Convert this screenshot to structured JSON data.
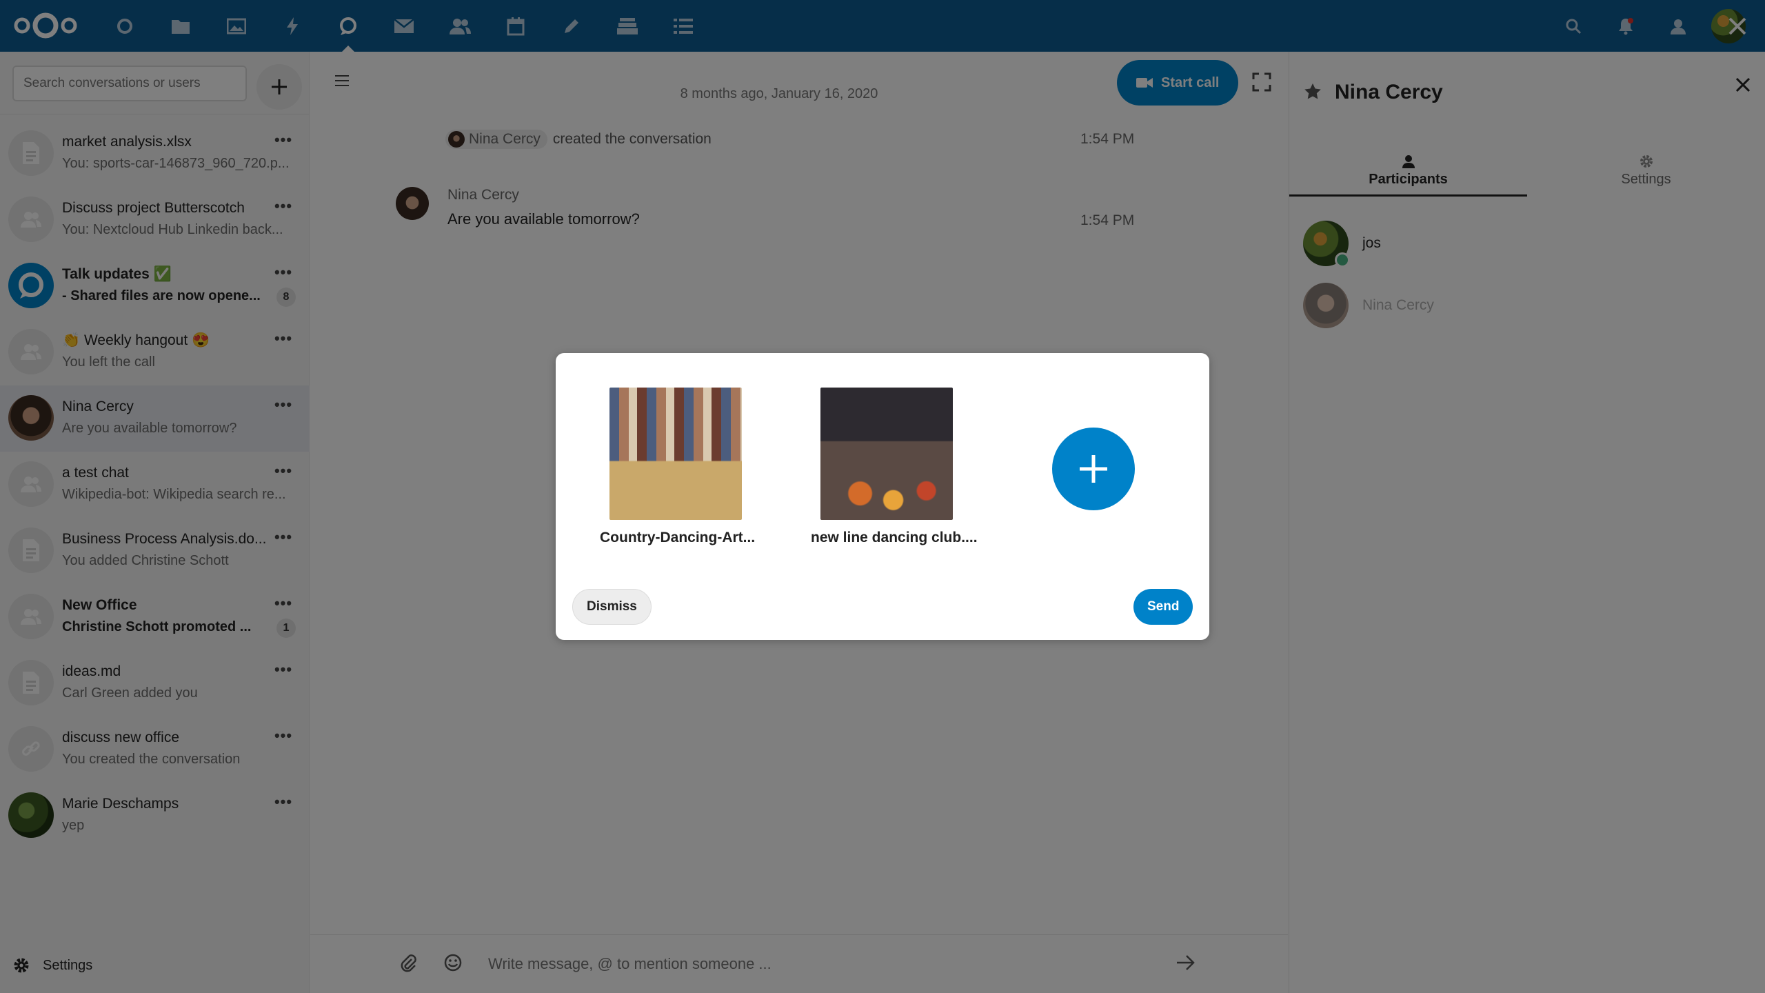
{
  "header": {
    "apps": [
      "dashboard",
      "files",
      "photos",
      "activity",
      "talk",
      "mail",
      "contacts",
      "calendar",
      "notes",
      "deck",
      "tasks"
    ],
    "active_app": "talk",
    "colors": {
      "header_bg": "#0c5d93",
      "accent": "#0082c9"
    }
  },
  "sidebar": {
    "search_placeholder": "Search conversations or users",
    "settings_label": "Settings",
    "conversations": [
      {
        "name": "market analysis.xlsx",
        "sub": "You: sports-car-146873_960_720.p...",
        "icon": "document-icon"
      },
      {
        "name": "Discuss project Butterscotch",
        "sub": "You: Nextcloud Hub Linkedin back...",
        "icon": "group-icon"
      },
      {
        "name": "Talk updates ✅",
        "sub": "- Shared files are now opene...",
        "icon": "talk-icon",
        "badge": "8",
        "bold": true
      },
      {
        "name": "👏 Weekly hangout 😍",
        "sub": "You left the call",
        "icon": "group-icon"
      },
      {
        "name": "Nina Cercy",
        "sub": "Are you available tomorrow?",
        "icon": "avatar",
        "active": true
      },
      {
        "name": "a test chat",
        "sub": "Wikipedia-bot: Wikipedia search re...",
        "icon": "group-icon"
      },
      {
        "name": "Business Process Analysis.do...",
        "sub": "You added Christine Schott",
        "icon": "document-icon"
      },
      {
        "name": "New Office",
        "sub": "Christine Schott promoted ...",
        "icon": "group-icon",
        "badge": "1",
        "bold": true
      },
      {
        "name": "ideas.md",
        "sub": "Carl Green added you",
        "icon": "document-icon"
      },
      {
        "name": "discuss new office",
        "sub": "You created the conversation",
        "icon": "link-icon"
      },
      {
        "name": "Marie Deschamps",
        "sub": "yep",
        "icon": "avatar"
      }
    ]
  },
  "chat": {
    "date_separator": "8 months ago, January 16, 2020",
    "start_call_label": "Start call",
    "system_message": {
      "actor": "Nina Cercy",
      "text": "created the conversation",
      "time": "1:54 PM"
    },
    "message": {
      "author": "Nina Cercy",
      "text": "Are you available tomorrow?",
      "time": "1:54 PM"
    },
    "composer_placeholder": "Write message, @ to mention someone ..."
  },
  "right_sidebar": {
    "title": "Nina Cercy",
    "tabs": [
      "Participants",
      "Settings"
    ],
    "active_tab": "Participants",
    "participants": [
      {
        "name": "jos",
        "online": true
      },
      {
        "name": "Nina Cercy",
        "online": false
      }
    ]
  },
  "upload_dialog": {
    "files": [
      {
        "name": "Country-Dancing-Art..."
      },
      {
        "name": "new line dancing club...."
      }
    ],
    "dismiss_label": "Dismiss",
    "send_label": "Send"
  }
}
